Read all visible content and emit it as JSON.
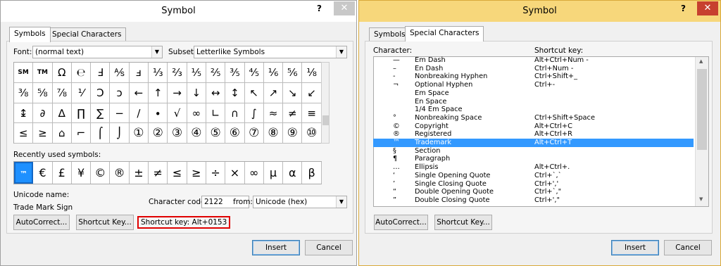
{
  "left": {
    "title": "Symbol",
    "help": "?",
    "close": "✕",
    "tabs": [
      "Symbols",
      "Special Characters"
    ],
    "font_label": "Font:",
    "font_value": "(normal text)",
    "subset_label": "Subset:",
    "subset_value": "Letterlike Symbols",
    "grid": [
      [
        "SM",
        "TM",
        "Ω",
        "℮",
        "Ⅎ",
        "⅍",
        "ⅎ",
        "⅓",
        "⅔",
        "⅕",
        "⅖",
        "⅗",
        "⅘",
        "⅙",
        "⅚",
        "⅛"
      ],
      [
        "⅜",
        "⅝",
        "⅞",
        "⅟",
        "Ↄ",
        "ↄ",
        "←",
        "↑",
        "→",
        "↓",
        "↔",
        "↕",
        "↖",
        "↗",
        "↘",
        "↙"
      ],
      [
        "↨",
        "∂",
        "∆",
        "∏",
        "∑",
        "−",
        "∕",
        "∙",
        "√",
        "∞",
        "∟",
        "∩",
        "∫",
        "≈",
        "≠",
        "≡"
      ],
      [
        "≤",
        "≥",
        "⌂",
        "⌐",
        "⌠",
        "⌡",
        "①",
        "②",
        "③",
        "④",
        "⑤",
        "⑥",
        "⑦",
        "⑧",
        "⑨",
        "⑩"
      ]
    ],
    "recent_label": "Recently used symbols:",
    "recent": [
      "™",
      "€",
      "£",
      "¥",
      "©",
      "®",
      "±",
      "≠",
      "≤",
      "≥",
      "÷",
      "×",
      "∞",
      "µ",
      "α",
      "β"
    ],
    "unicode_name_label": "Unicode name:",
    "unicode_name": "Trade Mark Sign",
    "char_code_label": "Character code:",
    "char_code": "2122",
    "from_label": "from:",
    "from_value": "Unicode (hex)",
    "autocorrect": "AutoCorrect...",
    "shortcut_key_btn": "Shortcut Key...",
    "shortcut_text": "Shortcut key: Alt+0153",
    "insert": "Insert",
    "cancel": "Cancel",
    "highlight_color": "#e00000"
  },
  "right": {
    "title": "Symbol",
    "help": "?",
    "close": "✕",
    "tabs": [
      "Symbols",
      "Special Characters"
    ],
    "col_character": "Character:",
    "col_shortcut": "Shortcut key:",
    "rows": [
      {
        "glyph": "—",
        "name": "Em Dash",
        "key": "Alt+Ctrl+Num -"
      },
      {
        "glyph": "–",
        "name": "En Dash",
        "key": "Ctrl+Num -"
      },
      {
        "glyph": "-",
        "name": "Nonbreaking Hyphen",
        "key": "Ctrl+Shift+_"
      },
      {
        "glyph": "¬",
        "name": "Optional Hyphen",
        "key": "Ctrl+-"
      },
      {
        "glyph": "",
        "name": "Em Space",
        "key": ""
      },
      {
        "glyph": "",
        "name": "En Space",
        "key": ""
      },
      {
        "glyph": "",
        "name": "1/4 Em Space",
        "key": ""
      },
      {
        "glyph": "°",
        "name": "Nonbreaking Space",
        "key": "Ctrl+Shift+Space"
      },
      {
        "glyph": "©",
        "name": "Copyright",
        "key": "Alt+Ctrl+C"
      },
      {
        "glyph": "®",
        "name": "Registered",
        "key": "Alt+Ctrl+R"
      },
      {
        "glyph": "™",
        "name": "Trademark",
        "key": "Alt+Ctrl+T"
      },
      {
        "glyph": "§",
        "name": "Section",
        "key": ""
      },
      {
        "glyph": "¶",
        "name": "Paragraph",
        "key": ""
      },
      {
        "glyph": "…",
        "name": "Ellipsis",
        "key": "Alt+Ctrl+."
      },
      {
        "glyph": "‘",
        "name": "Single Opening Quote",
        "key": "Ctrl+`,`"
      },
      {
        "glyph": "’",
        "name": "Single Closing Quote",
        "key": "Ctrl+','"
      },
      {
        "glyph": "“",
        "name": "Double Opening Quote",
        "key": "Ctrl+`,\""
      },
      {
        "glyph": "”",
        "name": "Double Closing Quote",
        "key": "Ctrl+',\""
      }
    ],
    "selected_index": 10,
    "autocorrect": "AutoCorrect...",
    "shortcut_key_btn": "Shortcut Key...",
    "insert": "Insert",
    "cancel": "Cancel"
  }
}
